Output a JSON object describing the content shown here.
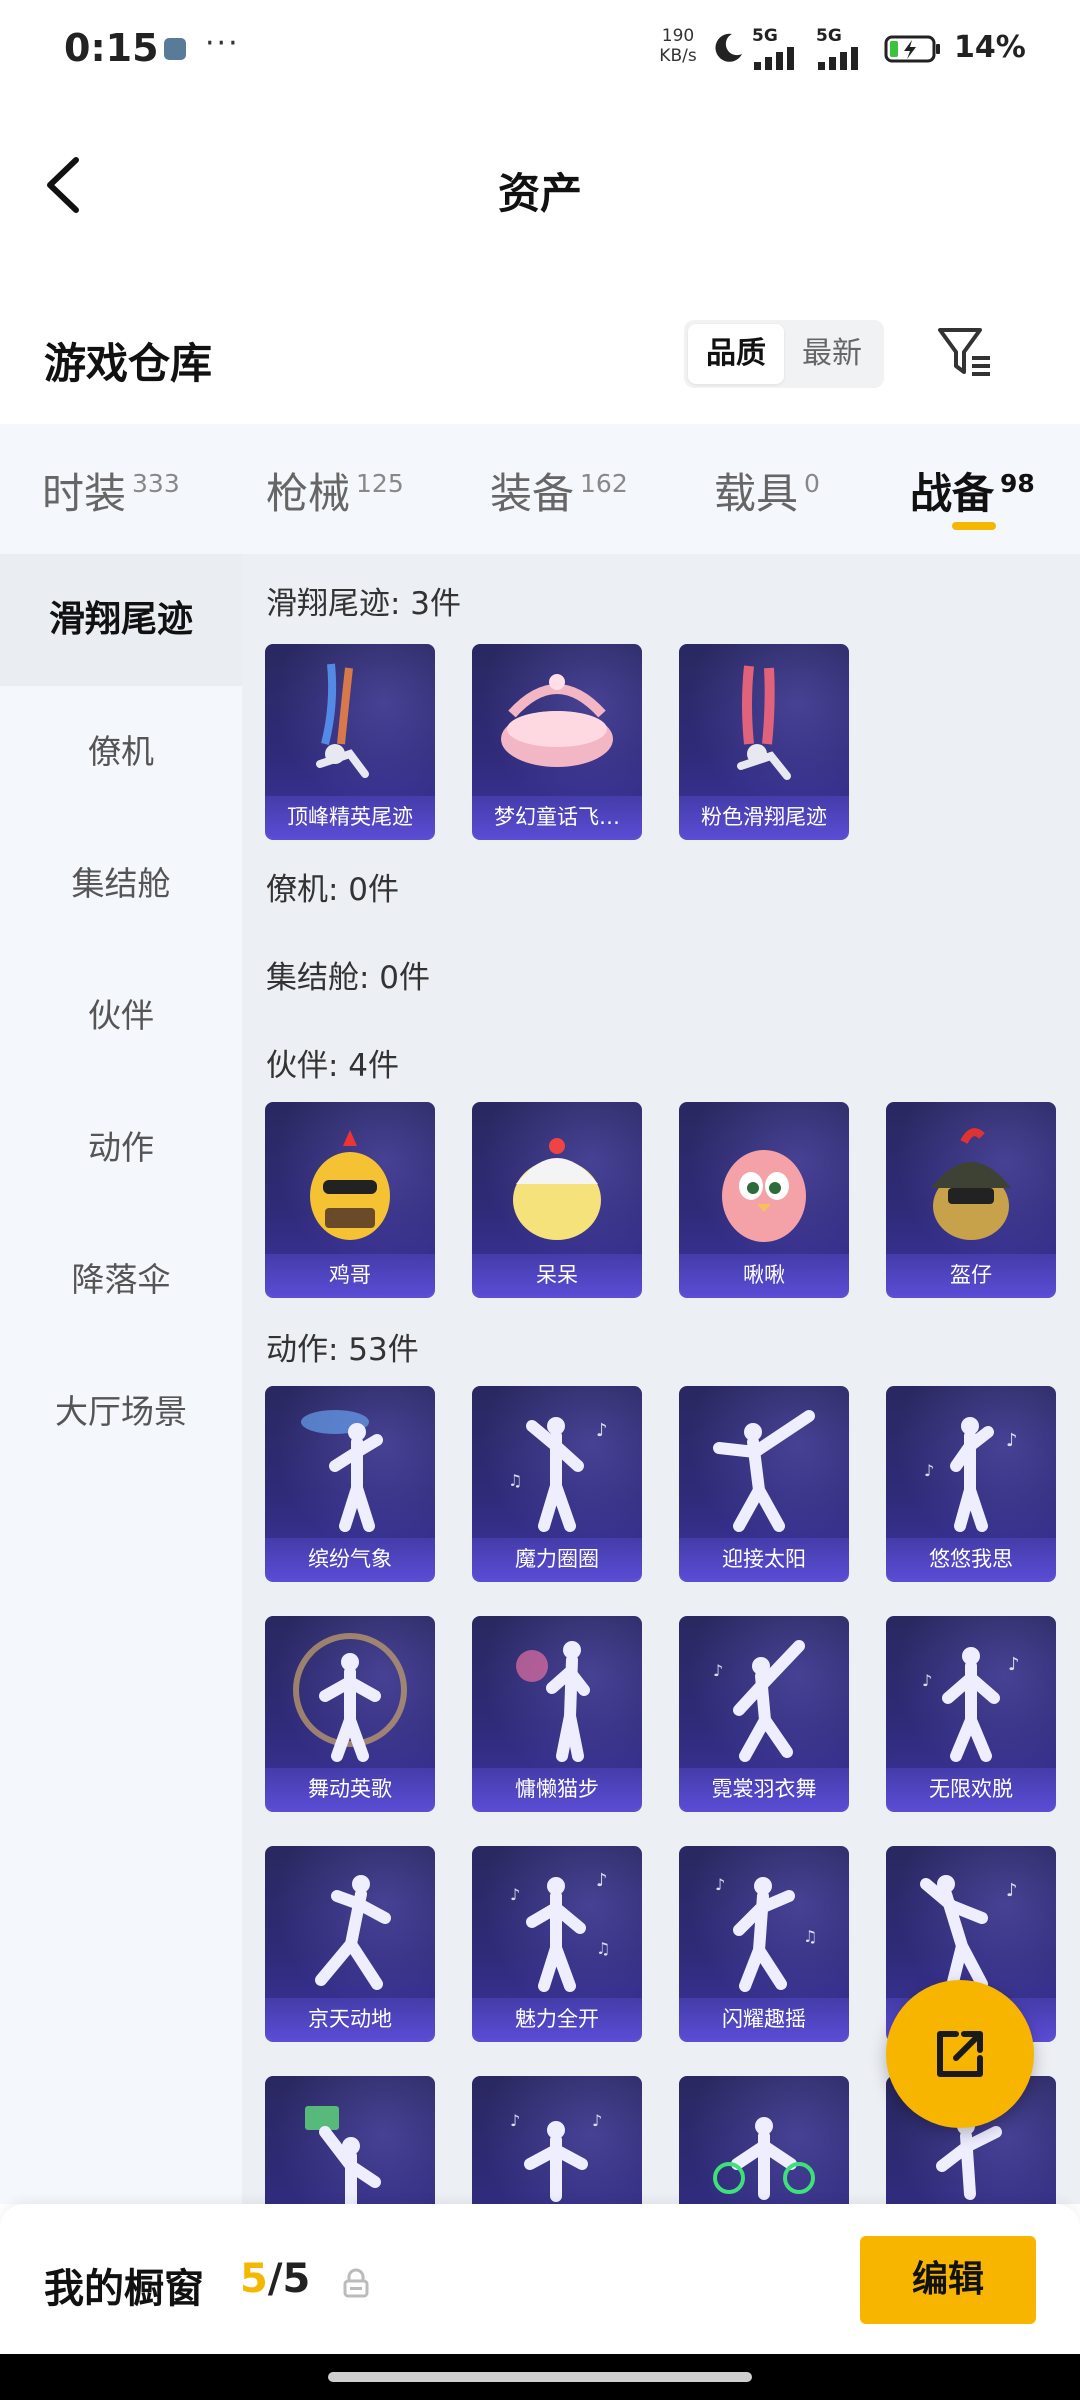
{
  "status_bar": {
    "time": "0:15",
    "speed_value": "190",
    "speed_unit": "KB/s",
    "sim1_label": "5G",
    "sim2_label": "5G",
    "battery_pct": "14%",
    "more_glyph": "···"
  },
  "header": {
    "title": "资产",
    "back_icon": "chevron-left-icon"
  },
  "warehouse": {
    "title": "游戏仓库",
    "sort_options": [
      "品质",
      "最新"
    ],
    "sort_selected": "品质",
    "filter_icon": "filter-icon"
  },
  "category_tabs": [
    {
      "label": "时装",
      "count": "333"
    },
    {
      "label": "枪械",
      "count": "125"
    },
    {
      "label": "装备",
      "count": "162"
    },
    {
      "label": "载具",
      "count": "0"
    },
    {
      "label": "战备",
      "count": "98"
    }
  ],
  "active_category": "战备",
  "sidebar": {
    "items": [
      "滑翔尾迹",
      "僚机",
      "集结舱",
      "伙伴",
      "动作",
      "降落伞",
      "大厅场景"
    ],
    "selected": "滑翔尾迹"
  },
  "groups": {
    "glide": {
      "label": "滑翔尾迹: 3件",
      "items": [
        "顶峰精英尾迹",
        "梦幻童话飞…",
        "粉色滑翔尾迹"
      ]
    },
    "wingman": {
      "label": "僚机: 0件"
    },
    "pod": {
      "label": "集结舱: 0件"
    },
    "partner": {
      "label": "伙伴: 4件",
      "items": [
        "鸡哥",
        "呆呆",
        "啾啾",
        "盔仔"
      ]
    },
    "emote": {
      "label": "动作: 53件",
      "items": [
        "缤纷气象",
        "魔力圈圈",
        "迎接太阳",
        "悠悠我思",
        "舞动英歌",
        "慵懒猫步",
        "霓裳羽衣舞",
        "无限欢脱",
        "京天动地",
        "魅力全开",
        "闪耀趣摇",
        "",
        "",
        "",
        "",
        ""
      ]
    }
  },
  "bottom_bar": {
    "showcase_label": "我的橱窗",
    "current": "5",
    "separator": "/",
    "total": "5",
    "edit_label": "编辑"
  },
  "colors": {
    "accent": "#f7b500",
    "card_bg": "#2f2b78",
    "card_label_bg": "#5a4fd6"
  }
}
